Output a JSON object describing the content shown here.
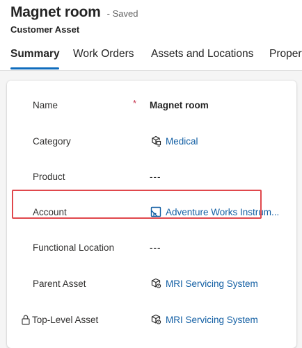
{
  "header": {
    "title": "Magnet room",
    "save_status": "- Saved",
    "entity_type": "Customer Asset"
  },
  "tabs": [
    {
      "label": "Summary",
      "active": true
    },
    {
      "label": "Work Orders",
      "active": false
    },
    {
      "label": "Assets and Locations",
      "active": false
    },
    {
      "label": "Properties",
      "active": false
    }
  ],
  "form": {
    "name": {
      "label": "Name",
      "required_marker": "*",
      "value": "Magnet room"
    },
    "category": {
      "label": "Category",
      "value": "Medical",
      "icon": "category-icon"
    },
    "product": {
      "label": "Product",
      "value": "---"
    },
    "account": {
      "label": "Account",
      "value": "Adventure Works Instrum...",
      "icon": "account-icon"
    },
    "functional_location": {
      "label": "Functional Location",
      "value": "---"
    },
    "parent_asset": {
      "label": "Parent Asset",
      "value": "MRI Servicing System",
      "icon": "asset-icon"
    },
    "top_level_asset": {
      "label": "Top-Level Asset",
      "value": "MRI Servicing System",
      "icon": "asset-icon",
      "locked_icon": "lock-icon"
    }
  },
  "colors": {
    "link": "#115ea3",
    "accent": "#0f6cbd",
    "highlight": "#e0474c",
    "required": "#c4314b"
  }
}
